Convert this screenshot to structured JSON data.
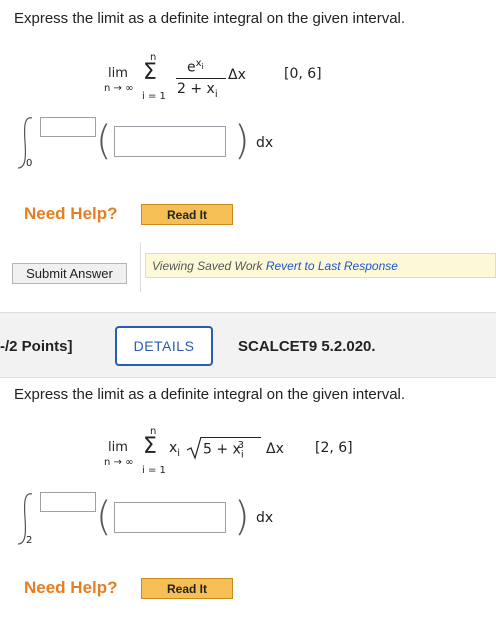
{
  "q1": {
    "prompt": "Express the limit as a definite integral on the given interval.",
    "sum_upper": "n",
    "lim": "lim",
    "lim_sub": "n → ∞",
    "sum_lower": "i = 1",
    "numerator": "e",
    "numerator_exp": "x",
    "numerator_exp_sub": "i",
    "denominator": "2 + x",
    "denominator_sub": "i",
    "delta_x": "Δx",
    "interval": "[0, 6]",
    "lower_limit": "0",
    "dx": "dx",
    "upper_limit_value": "",
    "integrand_value": "",
    "need_help": "Need Help?",
    "read_it": "Read It"
  },
  "submit": {
    "label": "Submit Answer",
    "saved_text": "Viewing Saved Work",
    "revert_link": "Revert to Last Response"
  },
  "q2": {
    "points": "-/2 Points]",
    "details": "DETAILS",
    "code": "SCALCET9 5.2.020.",
    "prompt": "Express the limit as a definite integral on the given interval.",
    "sum_upper": "n",
    "lim": "lim",
    "lim_sub": "n → ∞",
    "sum_lower": "i = 1",
    "term": "x",
    "term_sub": "i",
    "radicand": "5 + x",
    "radicand_sub": "i",
    "radicand_exp": "3",
    "delta_x": "Δx",
    "interval": "[2, 6]",
    "lower_limit": "2",
    "dx": "dx",
    "upper_limit_value": "",
    "integrand_value": "",
    "need_help": "Need Help?",
    "read_it": "Read It"
  },
  "colors": {
    "need_help": "#e67e22",
    "read_it_bg": "#f6bf55",
    "details_blue": "#2a5db0",
    "link_blue": "#1a56c9",
    "saved_bar_bg": "#fdf9d8"
  }
}
